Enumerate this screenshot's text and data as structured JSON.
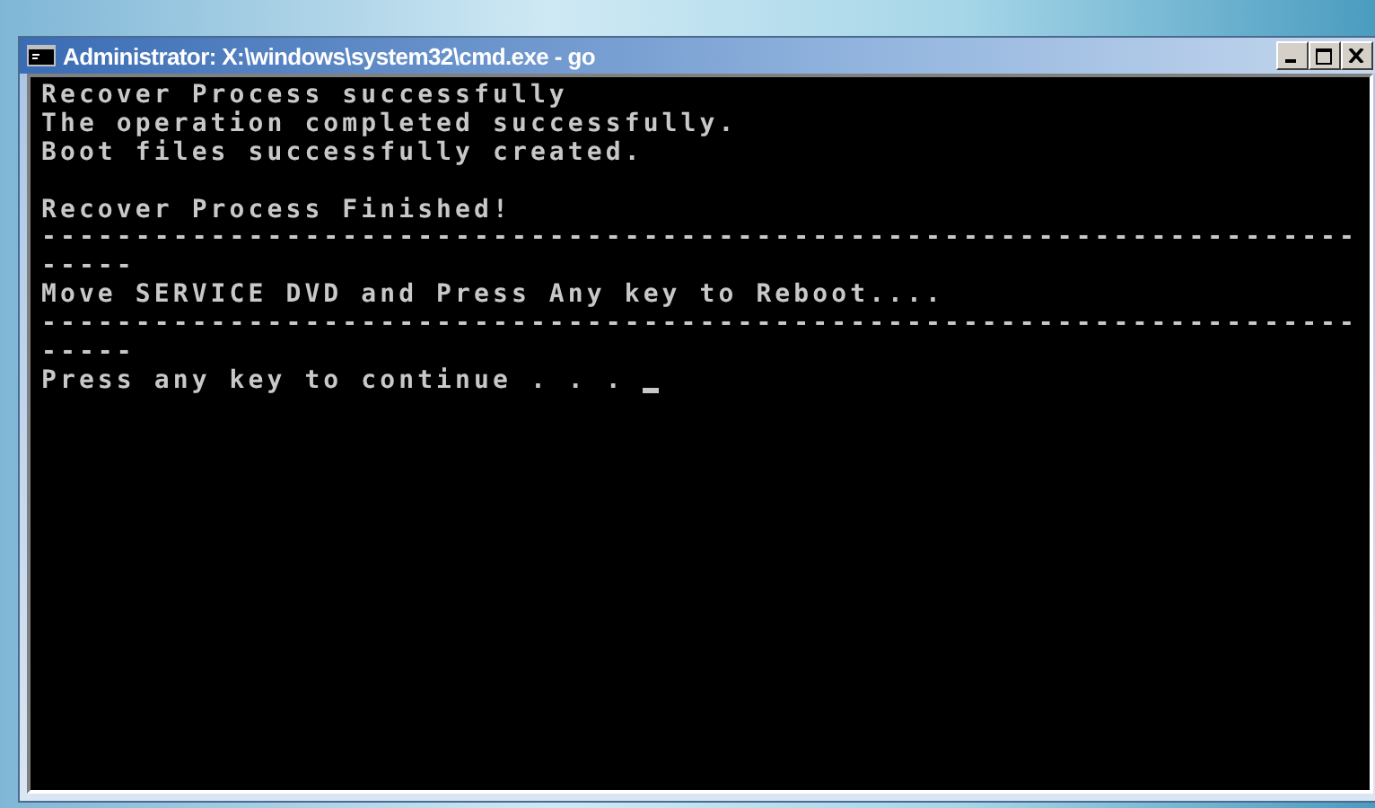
{
  "window": {
    "title": "Administrator: X:\\windows\\system32\\cmd.exe - go"
  },
  "console": {
    "lines": [
      {
        "kind": "text",
        "text": "Recover Process successfully"
      },
      {
        "kind": "text",
        "text": "The operation completed successfully."
      },
      {
        "kind": "text",
        "text": "Boot files successfully created."
      },
      {
        "kind": "blank"
      },
      {
        "kind": "text",
        "text": "Recover Process Finished!"
      },
      {
        "kind": "text",
        "text": "----------------------------------------------------------------------"
      },
      {
        "kind": "text",
        "text": "-----"
      },
      {
        "kind": "text",
        "text": "Move SERVICE DVD and Press Any key to Reboot...."
      },
      {
        "kind": "text",
        "text": "----------------------------------------------------------------------"
      },
      {
        "kind": "text",
        "text": "-----"
      },
      {
        "kind": "prompt",
        "text": "Press any key to continue . . . "
      }
    ]
  }
}
